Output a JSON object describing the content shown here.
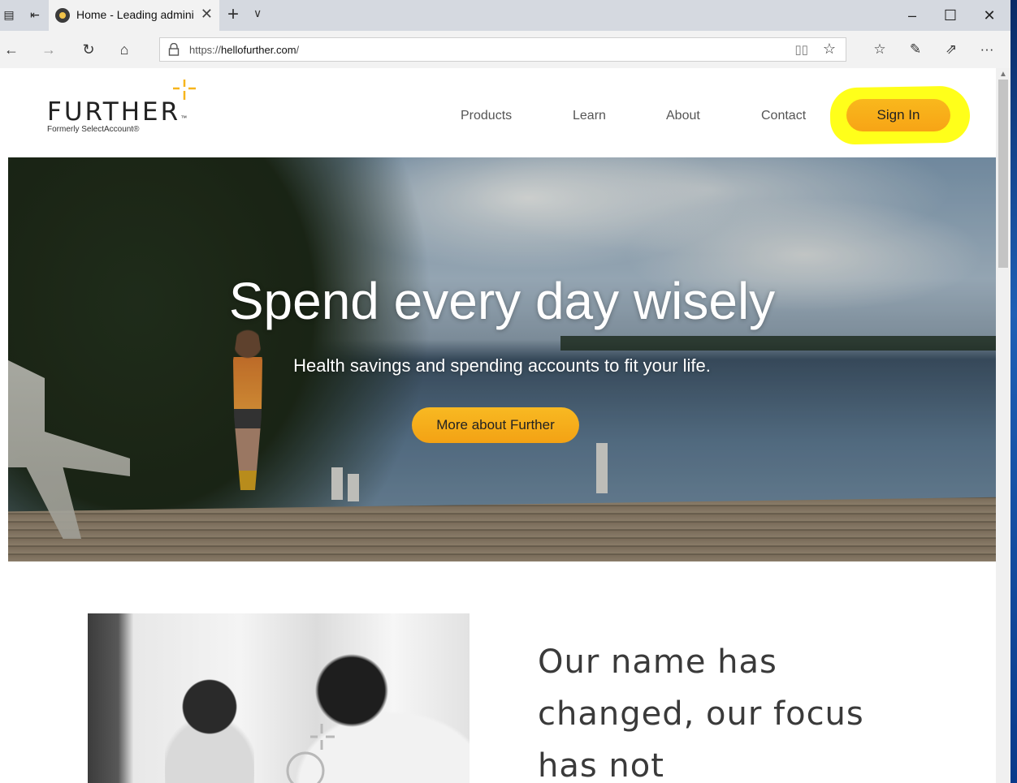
{
  "browser": {
    "tab_title": "Home - Leading admini",
    "url_scheme": "https://",
    "url_host": "hellofurther.com",
    "url_path": "/"
  },
  "site": {
    "logo_text": "FURTHER",
    "logo_tm": "™",
    "logo_sub": "Formerly SelectAccount®",
    "nav": [
      "Products",
      "Learn",
      "About",
      "Contact"
    ],
    "sign_in": "Sign In",
    "accent_color": "#f7a416",
    "highlight_color": "#ffff1a"
  },
  "hero": {
    "title": "Spend every day wisely",
    "subtitle": "Health savings and spending accounts to fit your life.",
    "button": "More about Further"
  },
  "section": {
    "headline_lines": [
      "Our name has",
      "changed, our focus",
      "has not"
    ]
  },
  "icons": [
    "back-arrow-icon",
    "forward-arrow-icon",
    "refresh-icon",
    "home-icon",
    "lock-icon",
    "reading-view-icon",
    "favorite-star-icon",
    "favorites-hub-icon",
    "pen-icon",
    "share-icon",
    "more-icon"
  ]
}
